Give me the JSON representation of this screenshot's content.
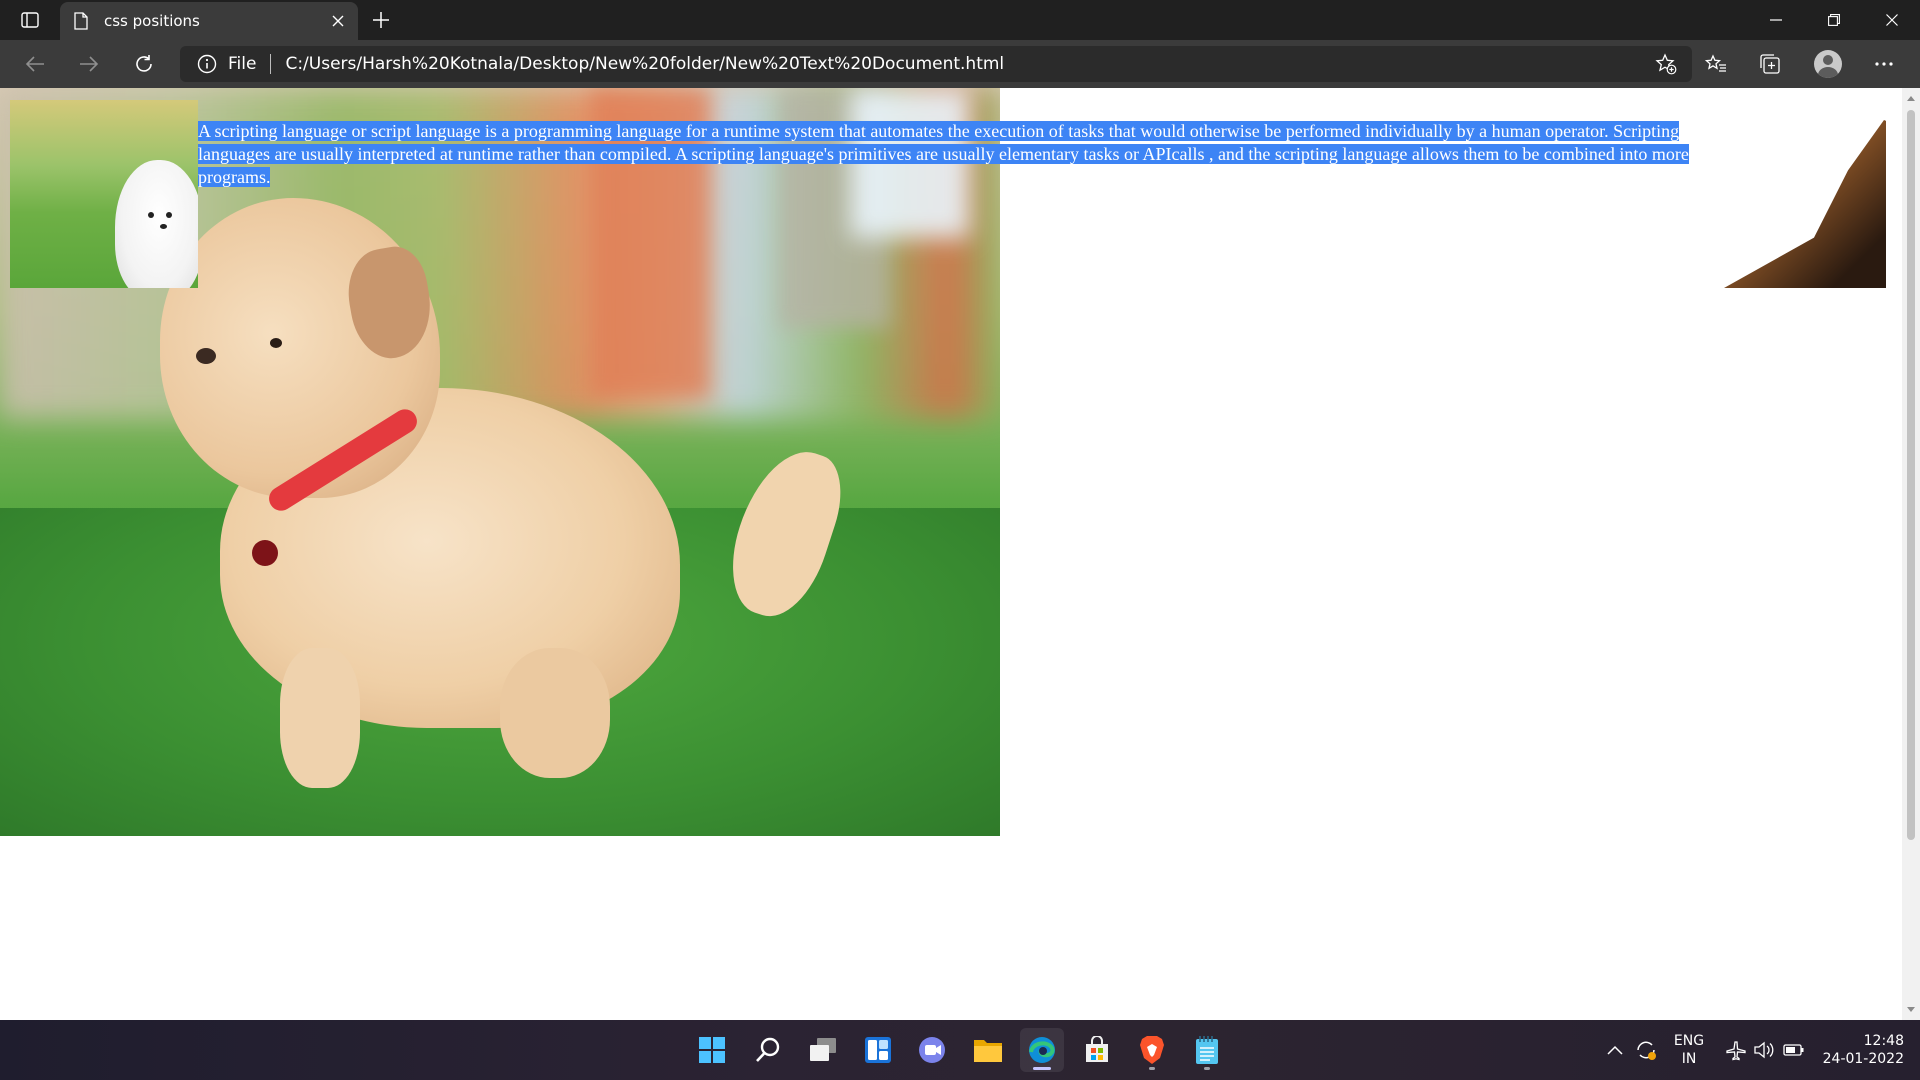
{
  "browser": {
    "tab": {
      "title": "css positions"
    },
    "address": {
      "scheme_label": "File",
      "url": "C:/Users/Harsh%20Kotnala/Desktop/New%20folder/New%20Text%20Document.html"
    }
  },
  "page": {
    "paragraph": "A scripting language or script language is a programming language for a runtime system that automates the execution of tasks that would otherwise be performed individually by a human operator. Scripting languages are usually interpreted at runtime rather than compiled. A scripting language's primitives are usually elementary tasks or APIcalls , and the scripting language allows them to be combined into more programs.",
    "images": [
      {
        "name": "white-puppy-thumbnail"
      },
      {
        "name": "golden-puppy-background"
      },
      {
        "name": "german-shepherd-image"
      }
    ],
    "selection_color": "#3d84f5"
  },
  "taskbar": {
    "apps": [
      "start-icon",
      "search-icon",
      "task-view-icon",
      "widgets-icon",
      "teams-chat-icon",
      "file-explorer-icon",
      "edge-icon",
      "store-icon",
      "brave-icon",
      "notepad-icon"
    ],
    "language": {
      "line1": "ENG",
      "line2": "IN"
    },
    "clock": {
      "time": "12:48",
      "date": "24-01-2022"
    }
  }
}
